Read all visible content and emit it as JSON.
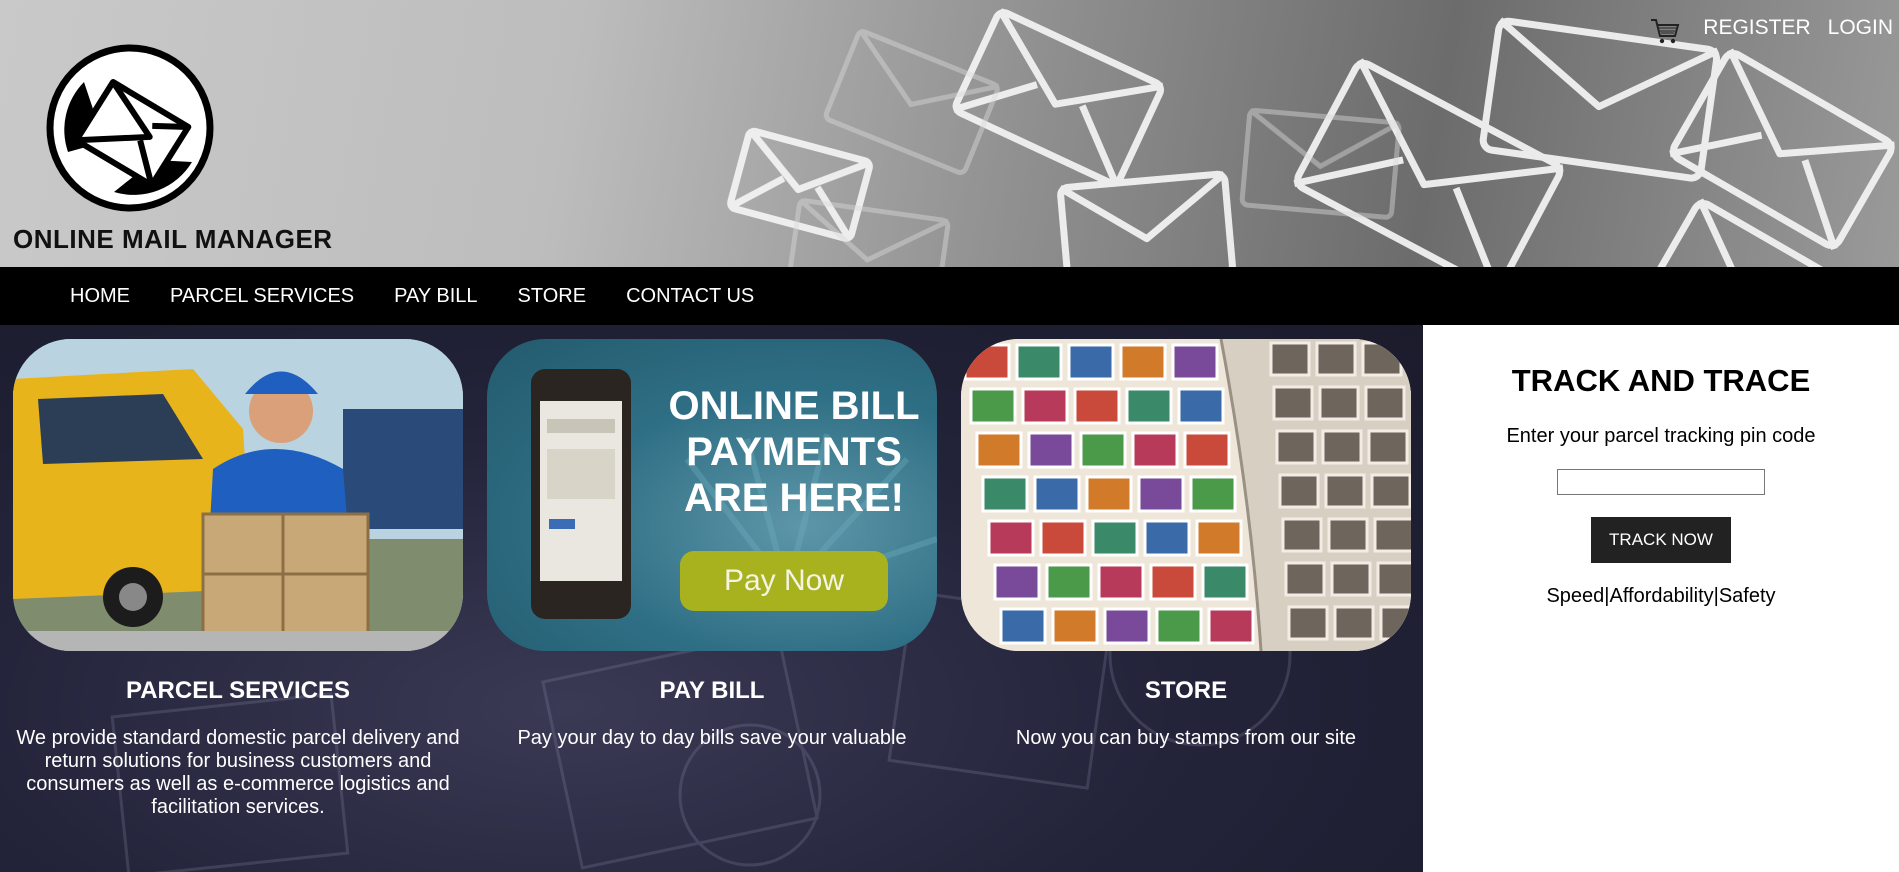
{
  "header": {
    "site_title": "ONLINE MAIL MANAGER",
    "links": [
      "REGISTER",
      "LOGIN"
    ]
  },
  "nav": {
    "items": [
      "HOME",
      "PARCEL SERVICES",
      "PAY BILL",
      "STORE",
      "CONTACT US"
    ]
  },
  "cards": [
    {
      "title": "PARCEL SERVICES",
      "description": "We provide standard domestic parcel delivery and return solutions for business customers and consumers as well as e-commerce logistics and facilitation services."
    },
    {
      "title": "PAY BILL",
      "description": "Pay your day to day bills save your valuable",
      "banner_lines": [
        "ONLINE BILL",
        "PAYMENTS",
        "ARE HERE!"
      ],
      "banner_button": "Pay Now"
    },
    {
      "title": "STORE",
      "description": "Now you can buy stamps from our site"
    }
  ],
  "track": {
    "title": "TRACK AND TRACE",
    "label": "Enter your parcel tracking pin code",
    "input_value": "",
    "button": "TRACK NOW",
    "tagline": "Speed|Affordability|Safety"
  },
  "colors": {
    "nav_bg": "#000000",
    "main_bg": "#23233a",
    "button_bg": "#222222",
    "pay_now_green": "#a8b21f"
  }
}
